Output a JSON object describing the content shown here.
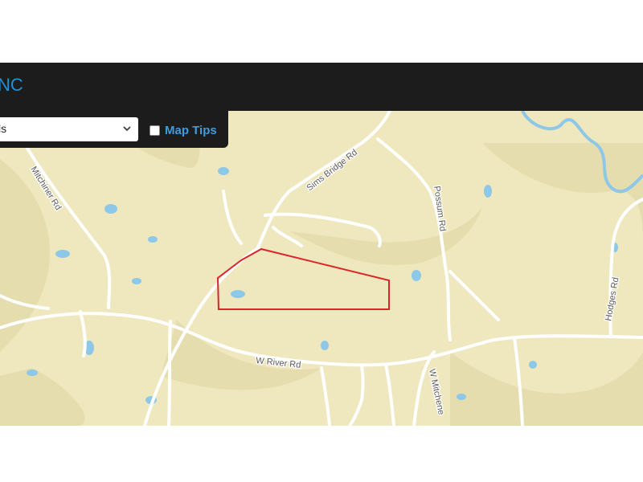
{
  "header": {
    "title": "NC"
  },
  "toolbar": {
    "layer_select_value": "ls",
    "map_tips_label": "Map Tips",
    "map_tips_checked": false
  },
  "map": {
    "road_labels": {
      "mitchiner": "Mitchiner Rd",
      "sims_bridge": "Sims Bridge Rd",
      "possum": "Possum Rd",
      "hodges": "Hodges Rd",
      "w_river": "W River Rd",
      "w_mitchener": "W Mitchene"
    },
    "colors": {
      "terrain": "#efe7bd",
      "water": "#8ec8e8",
      "road": "#ffffff",
      "parcel_outline": "#d8262a",
      "header_bg": "#1c1c1c",
      "title_blue": "#1e90d6"
    }
  }
}
